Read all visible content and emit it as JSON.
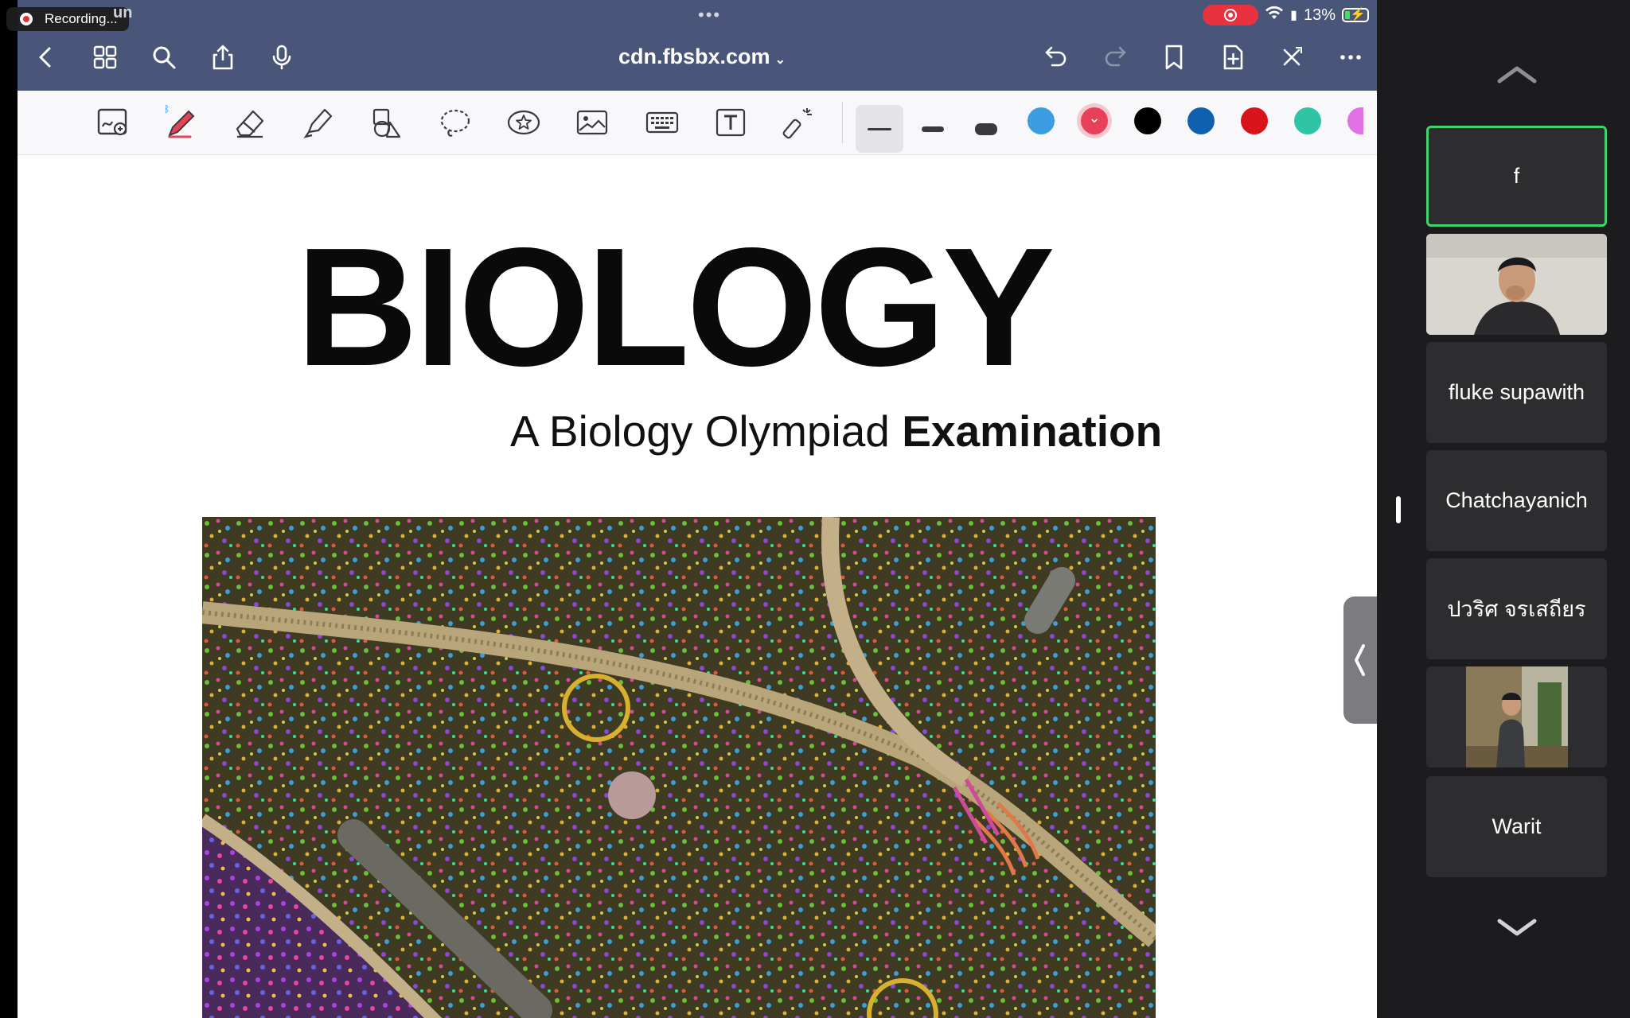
{
  "status_bar": {
    "recording_label": "Recording...",
    "left_faded": "un",
    "battery_percent": "13%"
  },
  "browser": {
    "url": "cdn.fbsbx.com",
    "icons": [
      "back-icon",
      "grid-icon",
      "search-icon",
      "share-icon",
      "microphone-icon",
      "undo-icon",
      "redo-icon",
      "bookmark-icon",
      "add-page-icon",
      "close-x-icon",
      "more-icon"
    ]
  },
  "tools": {
    "icons": [
      "zoom-window-icon",
      "pen-icon",
      "eraser-icon",
      "highlighter-icon",
      "shapes-icon",
      "lasso-icon",
      "sticker-icon",
      "image-icon",
      "keyboard-icon",
      "text-box-icon",
      "laser-pointer-icon"
    ],
    "stroke_widths": [
      "thin",
      "medium",
      "thick"
    ],
    "selected_stroke": "thin",
    "colors": [
      "#3b9ce0",
      "#e9405a",
      "#000000",
      "#1060b0",
      "#d8141a",
      "#2ec4a4",
      "#e070e6"
    ],
    "selected_color": "#e9405a"
  },
  "document": {
    "title": "BIOLOGY",
    "subtitle_regular": "A Biology Olympiad ",
    "subtitle_bold": "Examination"
  },
  "participants": [
    {
      "name": "f",
      "active": true,
      "has_video": false
    },
    {
      "name": "",
      "active": false,
      "has_video": true
    },
    {
      "name": "fluke supawith",
      "active": false,
      "has_video": false
    },
    {
      "name": "Chatchayanich",
      "active": false,
      "has_video": false
    },
    {
      "name": "ปวริศ จรเสถียร",
      "active": false,
      "has_video": false
    },
    {
      "name": "",
      "active": false,
      "has_video": true
    },
    {
      "name": "Warit",
      "active": false,
      "has_video": false
    }
  ]
}
